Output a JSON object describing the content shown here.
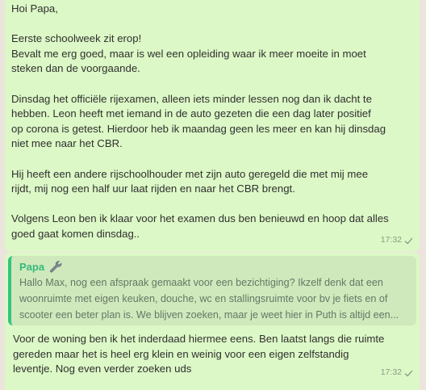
{
  "chat": {
    "message_1": {
      "text": "Hoi Papa,\n\nEerste schoolweek zit erop!\nBevalt me erg goed, maar is wel een opleiding waar ik meer moeite in moet\nsteken dan de voorgaande.\n\nDinsdag het officiële rijexamen, alleen iets minder lessen nog dan ik dacht te\nhebben. Leon heeft met iemand in de auto gezeten die een dag later positief\nop corona is getest. Hierdoor heb ik maandag geen les meer en kan hij dinsdag\nniet mee naar het CBR.\n\nHij heeft een andere rijschoolhouder met zijn auto geregeld die met mij mee\nrijdt, mij nog een half uur laat rijden en naar het CBR brengt.\n\nVolgens Leon ben ik klaar voor het examen dus ben benieuwd en hoop dat alles\ngoed gaat komen dinsdag..",
      "time": "17:32"
    },
    "message_2": {
      "quote": {
        "author": "Papa",
        "text": "Hallo Max, nog een afspraak gemaakt voor een bezichtiging? Ikzelf denk dat een\nwoonruimte met eigen keuken, douche, wc en stallingsruimte voor bv je fiets en of\nscooter een beter plan is. We blijven zoeken, maar je weet hier in Puth is altijd een..."
      },
      "text": "Voor de woning ben ik het inderdaad hiermee eens. Ben laatst langs die ruimte\ngereden maar het is heel erg klein en weinig voor een eigen zelfstandig\nleventje. Nog even verder zoeken uds",
      "time": "17:32"
    },
    "icons": {
      "tick": "single-check-icon",
      "quote_author_emoji": "wrench-icon"
    },
    "colors": {
      "bubble": "#dcf8c6",
      "quote_bar": "#35c47c",
      "quote_author": "#35b97a",
      "background": "#ece5dd"
    }
  }
}
